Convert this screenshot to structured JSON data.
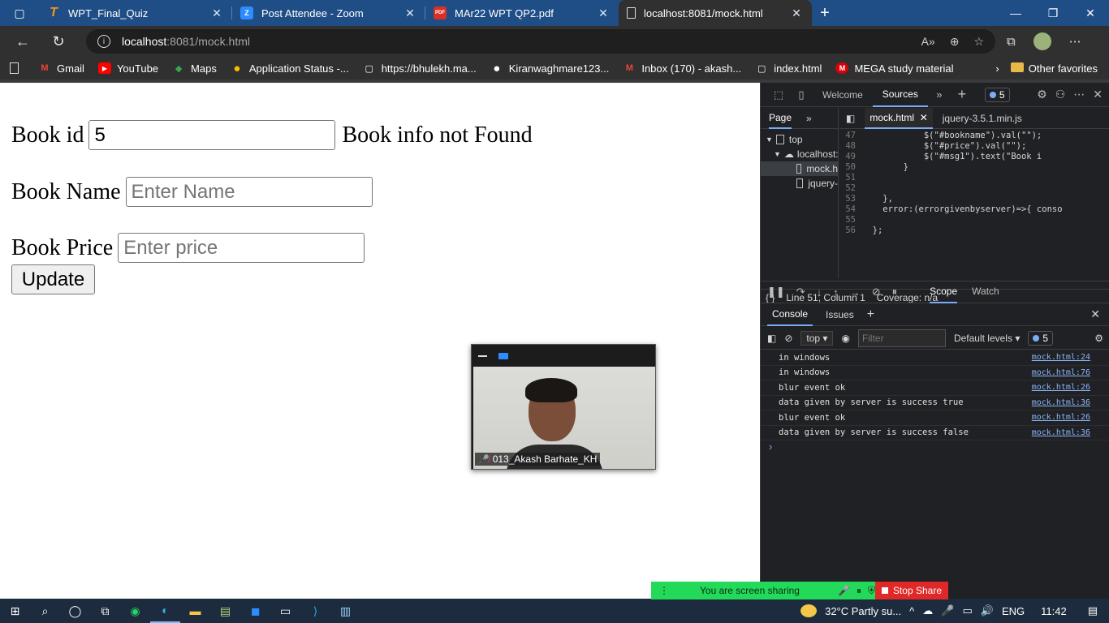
{
  "browser": {
    "tabs": [
      {
        "title": "WPT_Final_Quiz",
        "icon": "T",
        "color": "#f7931e"
      },
      {
        "title": "Post Attendee - Zoom",
        "icon": "Z",
        "color": "#2d8cff"
      },
      {
        "title": "MAr22 WPT QP2.pdf",
        "icon": "PDF",
        "color": "#d93025"
      },
      {
        "title": "localhost:8081/mock.html",
        "icon": "",
        "color": "#ffffff"
      }
    ],
    "url_host": "localhost",
    "url_path": ":8081/mock.html",
    "bookmarks": [
      {
        "label": "Gmail",
        "icon": "M",
        "color": "#ea4335"
      },
      {
        "label": "YouTube",
        "icon": "▶",
        "color": "#ff0000"
      },
      {
        "label": "Maps",
        "icon": "◆",
        "color": "#34a853"
      },
      {
        "label": "Application Status -...",
        "icon": "●",
        "color": "#fbbc04"
      },
      {
        "label": "https://bhulekh.ma...",
        "icon": "▢",
        "color": "#ffffff"
      },
      {
        "label": "Kiranwaghmare123...",
        "icon": "●",
        "color": "#ffffff"
      },
      {
        "label": "Inbox (170) - akash...",
        "icon": "M",
        "color": "#ea4335"
      },
      {
        "label": "index.html",
        "icon": "▢",
        "color": "#ffffff"
      },
      {
        "label": "MEGA study material",
        "icon": "M",
        "color": "#d90007"
      }
    ],
    "other_favorites": "Other favorites"
  },
  "form": {
    "book_id_label": "Book id",
    "book_id_value": "5",
    "message": "Book info not Found",
    "book_name_label": "Book Name",
    "book_name_placeholder": "Enter Name",
    "book_price_label": "Book Price",
    "book_price_placeholder": "Enter price",
    "update_button": "Update"
  },
  "zoom": {
    "participant": "013_Akash Barhate_KH"
  },
  "devtools": {
    "tabs": [
      "Welcome",
      "Sources"
    ],
    "active_tab": "Sources",
    "issue_count": "5",
    "nav_tabs": [
      "Page"
    ],
    "tree": [
      "top",
      "localhost:",
      "mock.h",
      "jquery-"
    ],
    "editor_tabs": [
      "mock.html",
      "jquery-3.5.1.min.js"
    ],
    "code_lines": [
      {
        "n": "47",
        "text": "            $(\"#bookname\").val(\"\");"
      },
      {
        "n": "48",
        "text": "            $(\"#price\").val(\"\");"
      },
      {
        "n": "49",
        "text": "            $(\"#msg1\").text(\"Book i"
      },
      {
        "n": "50",
        "text": "        }"
      },
      {
        "n": "51",
        "text": ""
      },
      {
        "n": "52",
        "text": ""
      },
      {
        "n": "53",
        "text": "    },"
      },
      {
        "n": "54",
        "text": "    error:(errorgivenbyserver)=>{ conso"
      },
      {
        "n": "55",
        "text": ""
      },
      {
        "n": "56",
        "text": "  };"
      }
    ],
    "status_position": "Line 51, Column 1",
    "status_coverage": "Coverage: n/a",
    "scope_tabs": [
      "Scope",
      "Watch"
    ],
    "console_tabs": [
      "Console",
      "Issues"
    ],
    "context": "top",
    "filter_placeholder": "Filter",
    "levels": "Default levels",
    "logs": [
      {
        "msg": "in windows",
        "src": "mock.html:24"
      },
      {
        "msg": "in windows",
        "src": "mock.html:76"
      },
      {
        "msg": "blur event ok",
        "src": "mock.html:26"
      },
      {
        "msg": "data given by server is success true",
        "src": "mock.html:36"
      },
      {
        "msg": "blur event ok",
        "src": "mock.html:26"
      },
      {
        "msg": "data given by server is success false",
        "src": "mock.html:36"
      }
    ]
  },
  "share": {
    "text": "You are screen sharing",
    "stop": "Stop Share"
  },
  "taskbar": {
    "weather": "32°C  Partly su...",
    "lang": "ENG",
    "time": "11:42"
  }
}
